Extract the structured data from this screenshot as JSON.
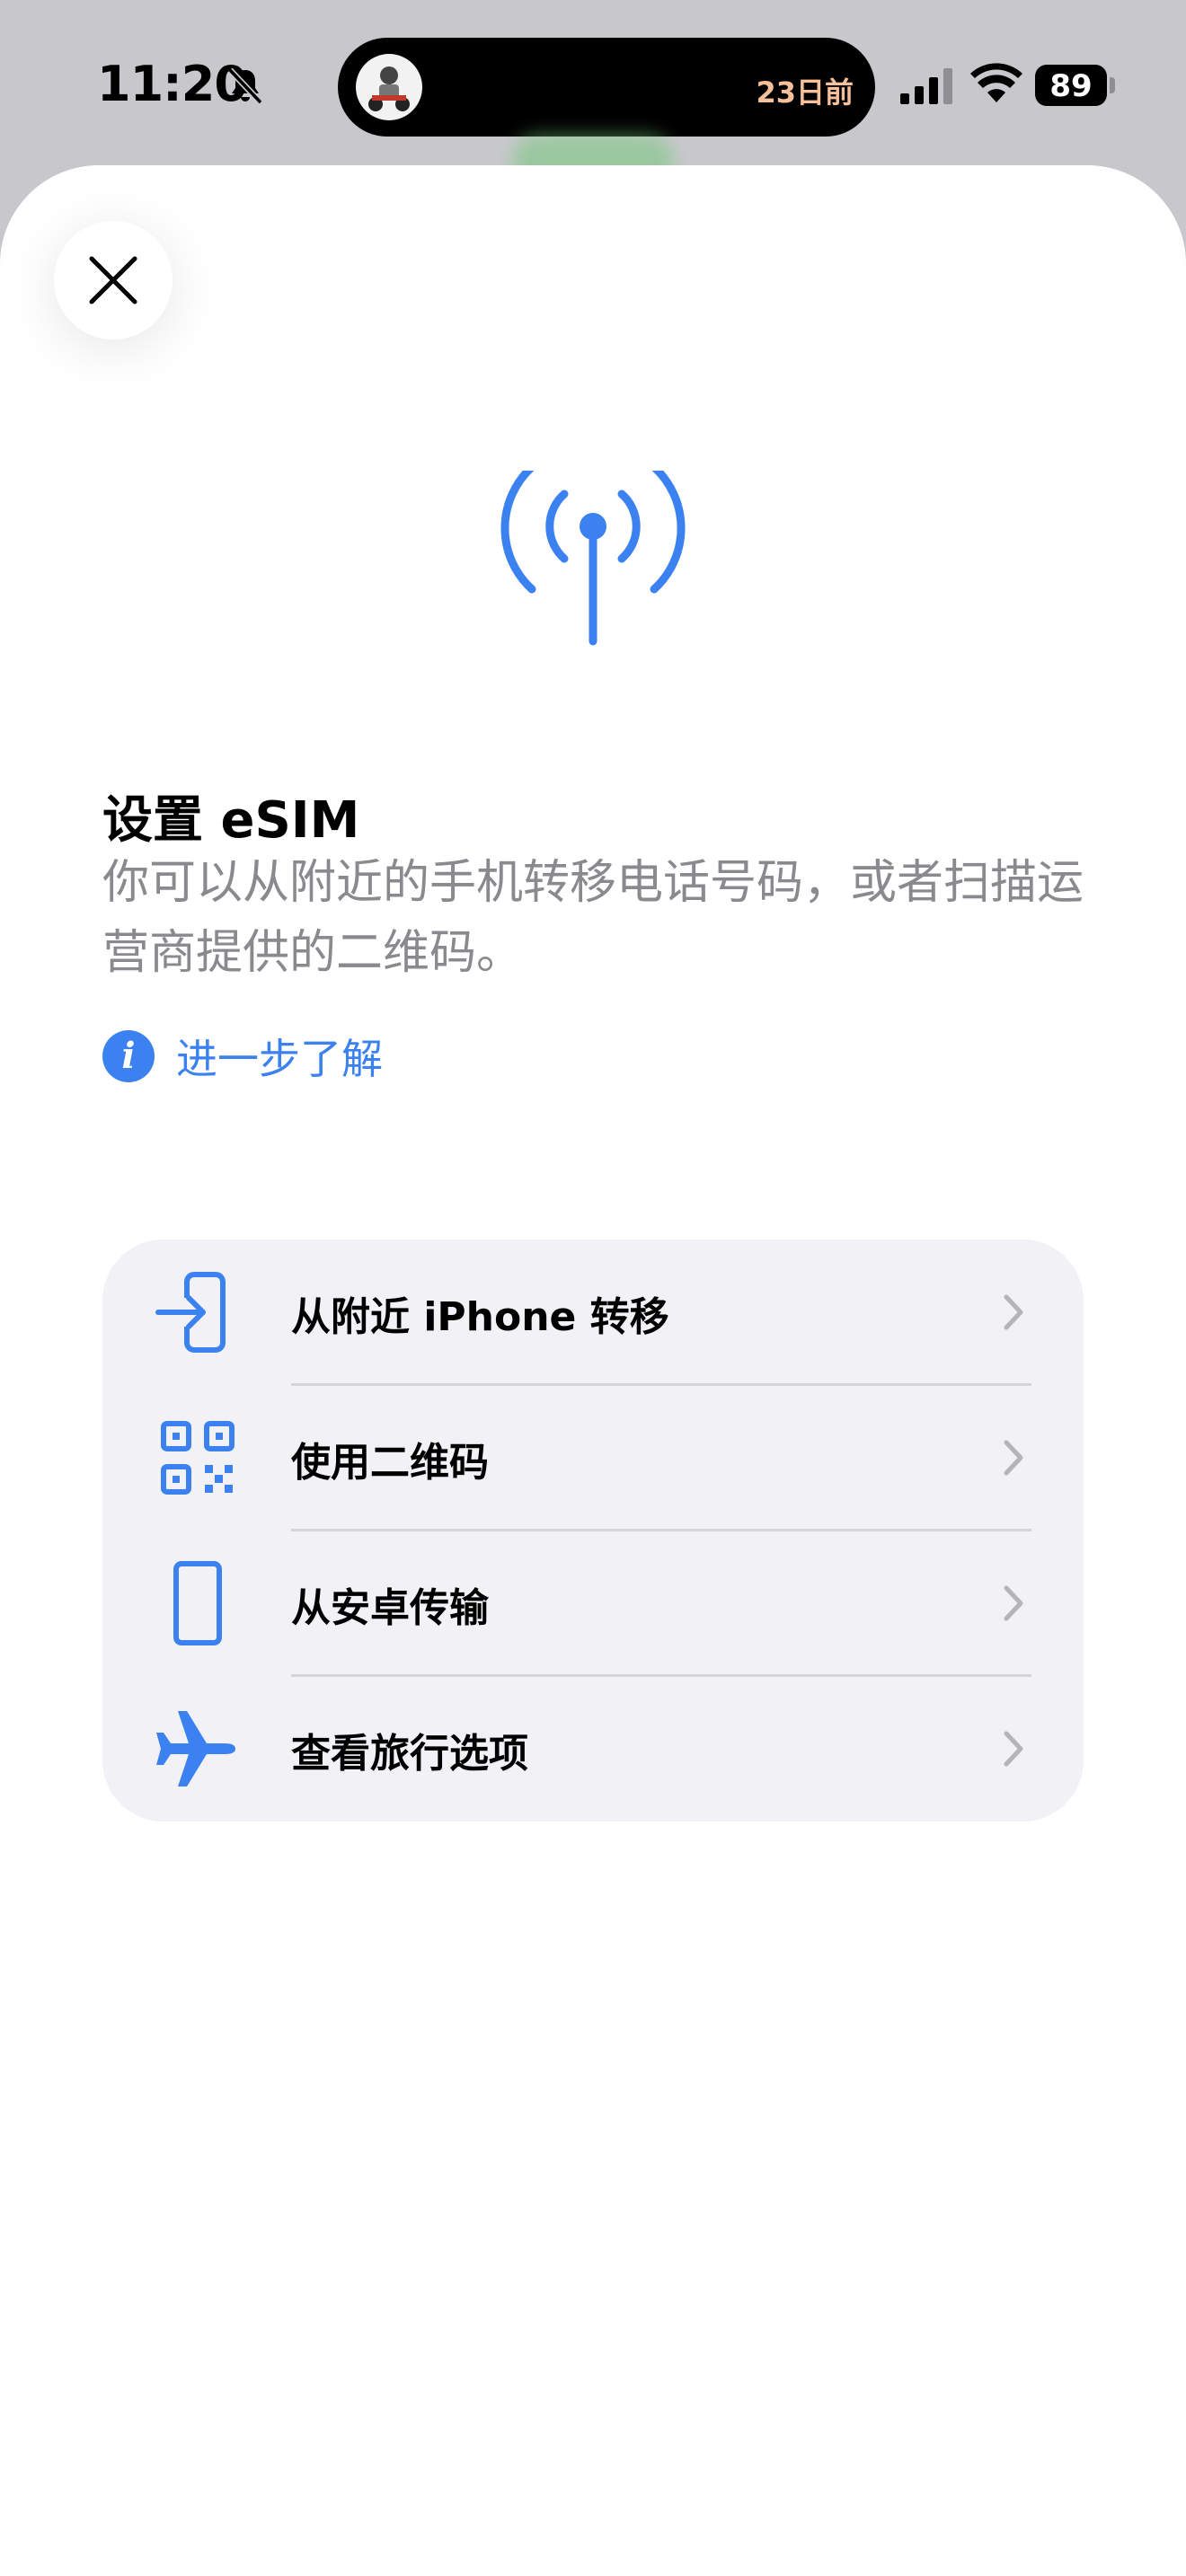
{
  "status_bar": {
    "time": "11:20",
    "island_text": "23日前",
    "battery": "89"
  },
  "header": {
    "title": "设置 eSIM",
    "subtitle": "你可以从附近的手机转移电话号码，或者扫描运营商提供的二维码。",
    "learn_more": "进一步了解"
  },
  "options": [
    {
      "label": "从附近 iPhone 转移",
      "icon": "transfer-icon"
    },
    {
      "label": "使用二维码",
      "icon": "qr-code-icon"
    },
    {
      "label": "从安卓传输",
      "icon": "phone-icon"
    },
    {
      "label": "查看旅行选项",
      "icon": "airplane-icon"
    }
  ],
  "colors": {
    "accent": "#3b82f0",
    "secondary_text": "#8a8a8e",
    "list_background": "#f1f1f6"
  }
}
